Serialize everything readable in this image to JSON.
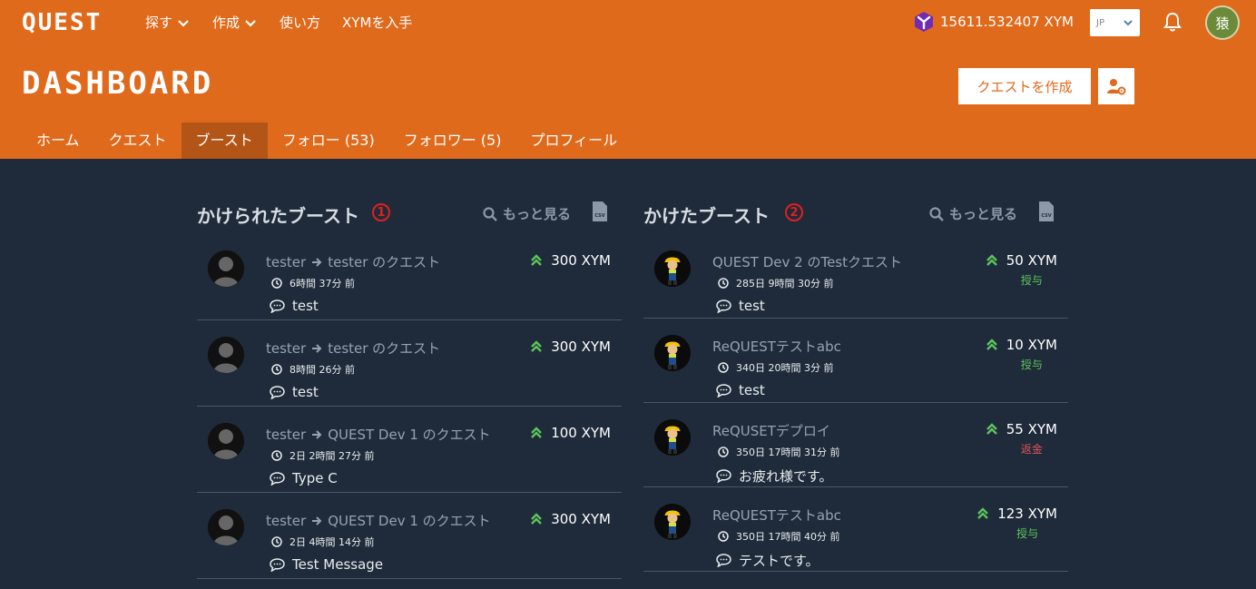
{
  "header": {
    "logo": "QUEST",
    "nav": [
      {
        "label": "探す",
        "dropdown": true
      },
      {
        "label": "作成",
        "dropdown": true
      },
      {
        "label": "使い方",
        "dropdown": false
      },
      {
        "label": "XYMを入手",
        "dropdown": false
      }
    ],
    "balance": "15611.532407 XYM",
    "lang": "JP",
    "avatar_text": "猿"
  },
  "page": {
    "title": "DASHBOARD",
    "create_button": "クエストを作成",
    "tabs": [
      {
        "label": "ホーム",
        "active": false
      },
      {
        "label": "クエスト",
        "active": false
      },
      {
        "label": "ブースト",
        "active": true
      },
      {
        "label": "フォロー (53)",
        "active": false
      },
      {
        "label": "フォロワー (5)",
        "active": false
      },
      {
        "label": "プロフィール",
        "active": false
      }
    ]
  },
  "received": {
    "title": "かけられたブースト",
    "marker": "1",
    "more": "もっと見る",
    "items": [
      {
        "from": "tester",
        "to": "tester のクエスト",
        "time": "6時間 37分 前",
        "message": "test",
        "amount": "300 XYM"
      },
      {
        "from": "tester",
        "to": "tester のクエスト",
        "time": "8時間 26分 前",
        "message": "test",
        "amount": "300 XYM"
      },
      {
        "from": "tester",
        "to": "QUEST Dev 1 のクエスト",
        "time": "2日 2時間 27分 前",
        "message": "Type C",
        "amount": "100 XYM"
      },
      {
        "from": "tester",
        "to": "QUEST Dev 1 のクエスト",
        "time": "2日 4時間 14分 前",
        "message": "Test Message",
        "amount": "300 XYM"
      }
    ]
  },
  "given": {
    "title": "かけたブースト",
    "marker": "2",
    "more": "もっと見る",
    "items": [
      {
        "title": "QUEST Dev 2 のTestクエスト",
        "time": "285日 9時間 30分 前",
        "message": "test",
        "amount": "50 XYM",
        "status": "授与",
        "status_color": "#5cc45c"
      },
      {
        "title": "ReQUESTテストabc",
        "time": "340日 20時間 3分 前",
        "message": "test",
        "amount": "10 XYM",
        "status": "授与",
        "status_color": "#5cc45c"
      },
      {
        "title": "ReQUSETデプロイ",
        "time": "350日 17時間 31分 前",
        "message": "お疲れ様です。",
        "amount": "55 XYM",
        "status": "返金",
        "status_color": "#e05555"
      },
      {
        "title": "ReQUESTテストabc",
        "time": "350日 17時間 40分 前",
        "message": "テストです。",
        "amount": "123 XYM",
        "status": "授与",
        "status_color": "#5cc45c"
      }
    ]
  }
}
